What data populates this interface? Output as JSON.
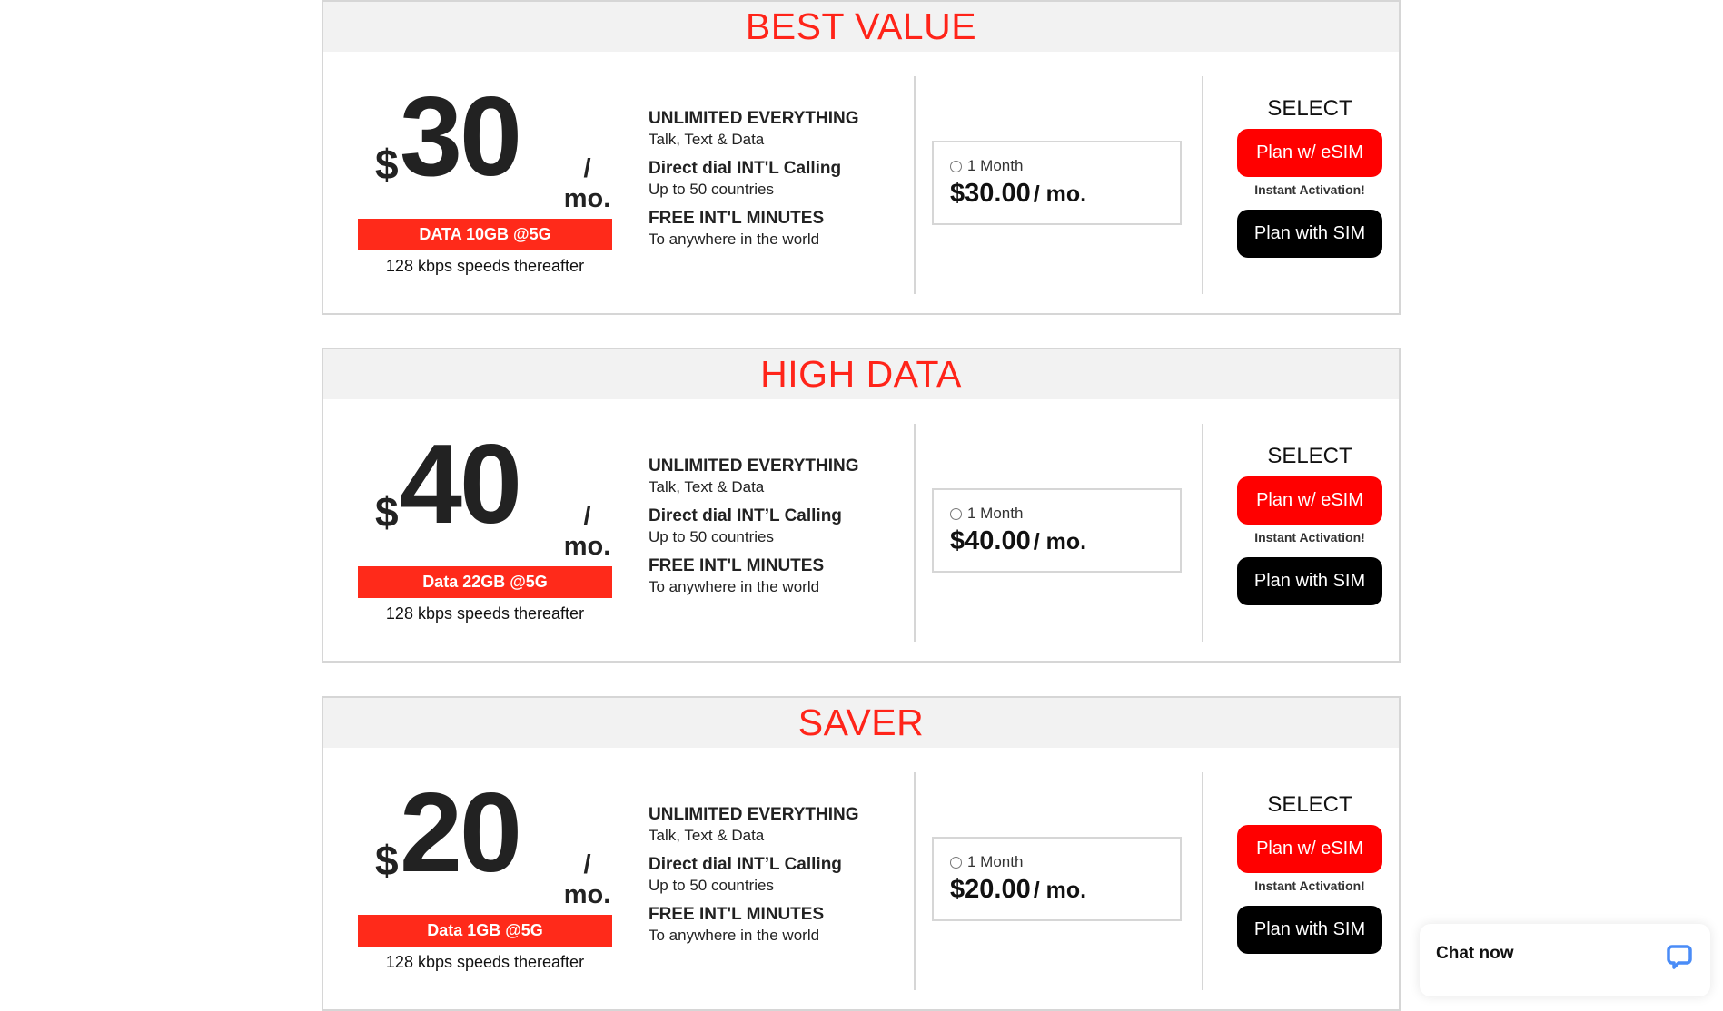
{
  "plans": [
    {
      "badge": "BEST VALUE",
      "currency": "$",
      "amount": "30",
      "per": "/ mo.",
      "data_allowance": "DATA 10GB @5G",
      "speed_note": "128 kbps speeds thereafter",
      "features": [
        {
          "title": "UNLIMITED EVERYTHING",
          "subtitle": "Talk, Text & Data"
        },
        {
          "title": "Direct dial INT'L Calling",
          "subtitle": "Up to 50 countries"
        },
        {
          "title": "FREE INT'L MINUTES",
          "subtitle": "To anywhere in the world"
        }
      ],
      "term_label": "1 Month",
      "term_price": "$30.00",
      "term_per": "/ mo.",
      "select_label": "SELECT",
      "esim_button": "Plan w/ eSIM",
      "esim_note": "Instant Activation!",
      "sim_button": "Plan with SIM"
    },
    {
      "badge": "HIGH DATA",
      "currency": "$",
      "amount": "40",
      "per": "/ mo.",
      "data_allowance": "Data 22GB @5G",
      "speed_note": "128 kbps speeds thereafter",
      "features": [
        {
          "title": "UNLIMITED EVERYTHING",
          "subtitle": "Talk, Text & Data"
        },
        {
          "title": "Direct dial INT’L Calling",
          "subtitle": "Up to 50 countries"
        },
        {
          "title": "FREE INT'L MINUTES",
          "subtitle": "To anywhere in the world"
        }
      ],
      "term_label": "1 Month",
      "term_price": "$40.00",
      "term_per": "/ mo.",
      "select_label": "SELECT",
      "esim_button": "Plan w/ eSIM",
      "esim_note": "Instant Activation!",
      "sim_button": "Plan with SIM"
    },
    {
      "badge": "SAVER",
      "currency": "$",
      "amount": "20",
      "per": "/ mo.",
      "data_allowance": "Data 1GB @5G",
      "speed_note": "128 kbps speeds thereafter",
      "features": [
        {
          "title": "UNLIMITED EVERYTHING",
          "subtitle": "Talk, Text & Data"
        },
        {
          "title": "Direct dial INT’L Calling",
          "subtitle": "Up to 50 countries"
        },
        {
          "title": "FREE INT'L MINUTES",
          "subtitle": "To anywhere in the world"
        }
      ],
      "term_label": "1 Month",
      "term_price": "$20.00",
      "term_per": "/ mo.",
      "select_label": "SELECT",
      "esim_button": "Plan w/ eSIM",
      "esim_note": "Instant Activation!",
      "sim_button": "Plan with SIM"
    }
  ],
  "chat_widget": {
    "label": "Chat now",
    "icon": "chat-bubble-icon"
  },
  "colors": {
    "accent_red": "#ff2419",
    "esim_button": "#ff0000",
    "sim_button": "#000000",
    "chat_icon": "#4a8cf7"
  }
}
